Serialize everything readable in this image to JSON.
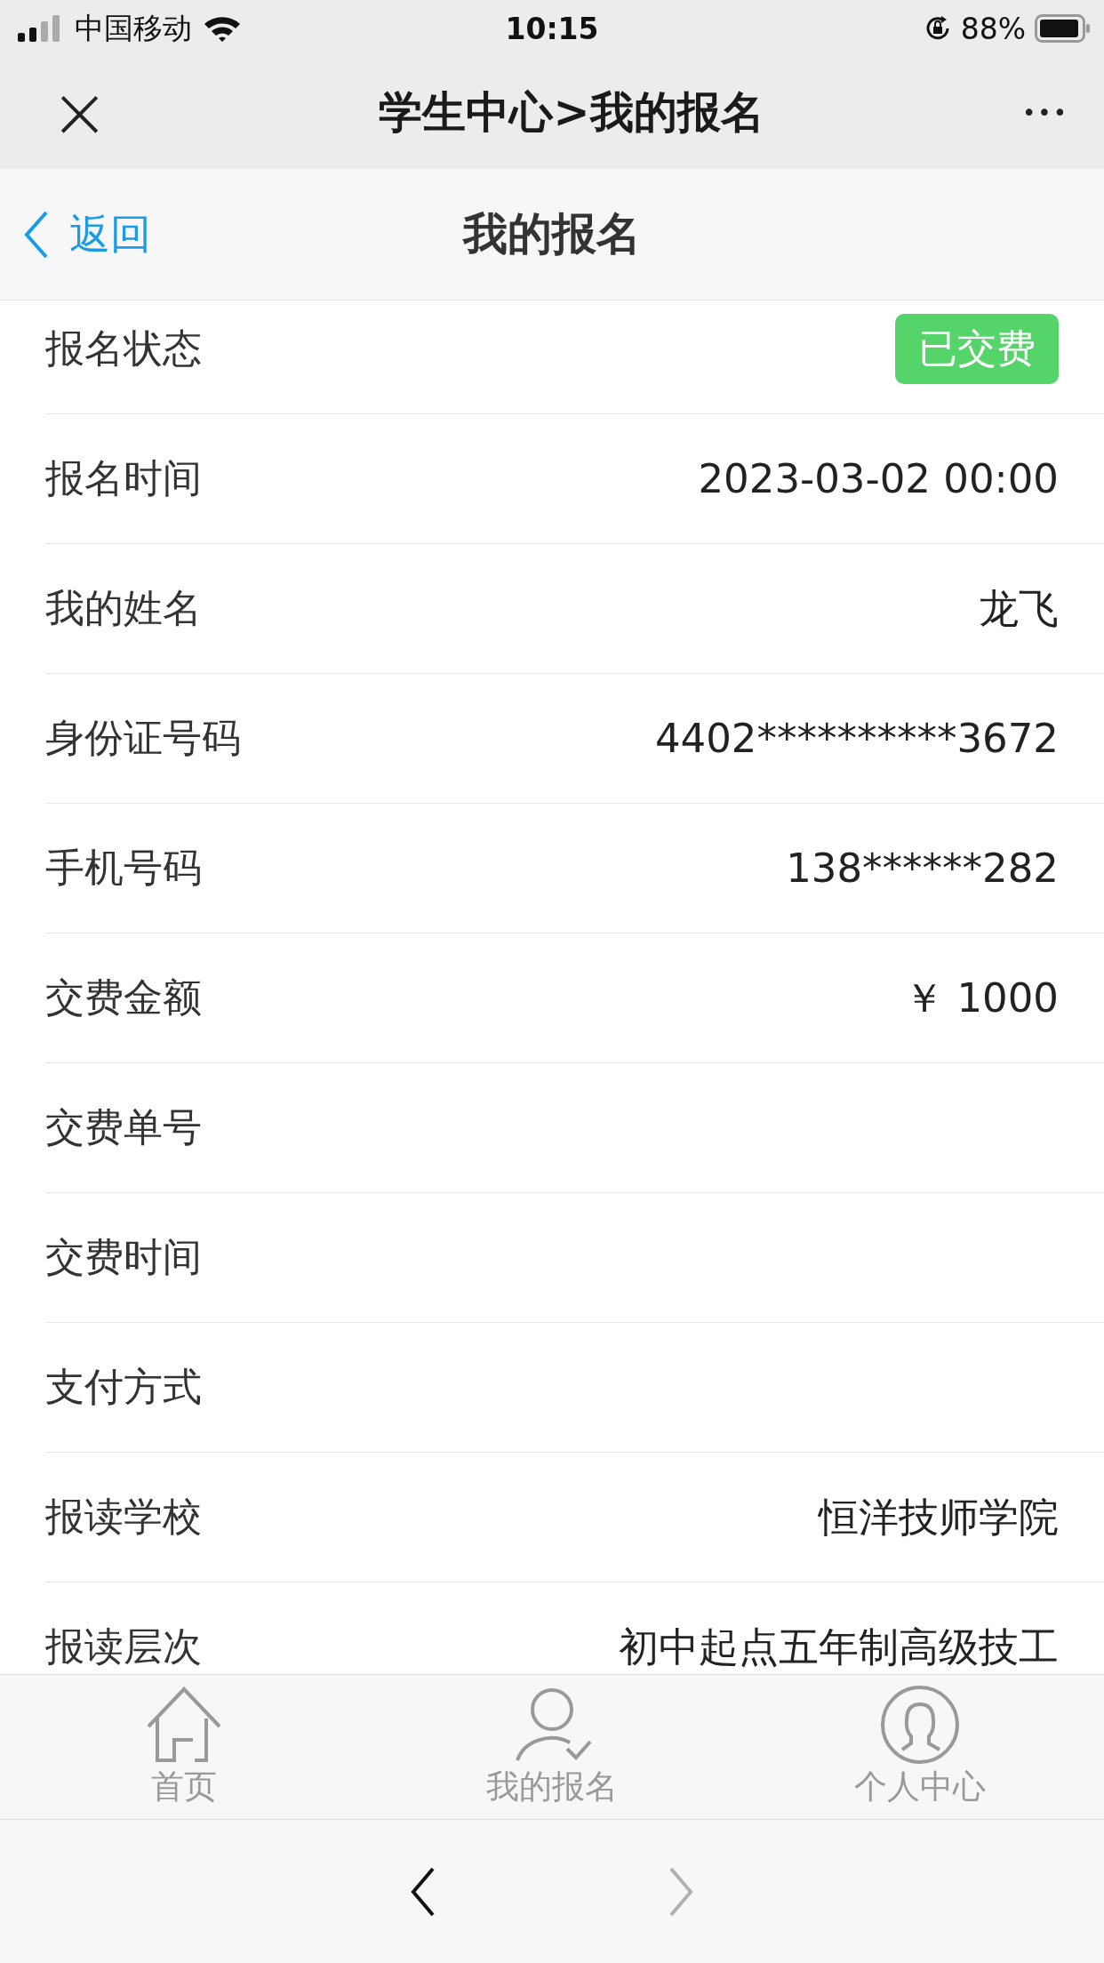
{
  "status_bar": {
    "carrier": "中国移动",
    "time": "10:15",
    "battery": "88%"
  },
  "nav_bar": {
    "close": "×",
    "title": "学生中心>我的报名",
    "more": "•••"
  },
  "page_header": {
    "back": "返回",
    "title": "我的报名"
  },
  "rows": [
    {
      "kind": "badge",
      "label": "报名状态",
      "value": "已交费",
      "color": "#55d46a"
    },
    {
      "kind": "text",
      "label": "报名时间",
      "value": "2023-03-02 00:00"
    },
    {
      "kind": "text",
      "label": "我的姓名",
      "value": "龙飞"
    },
    {
      "kind": "text",
      "label": "身份证号码",
      "value": "4402**********3672"
    },
    {
      "kind": "text",
      "label": "手机号码",
      "value": "138******282"
    },
    {
      "kind": "text",
      "label": "交费金额",
      "value": "￥ 1000"
    },
    {
      "kind": "text",
      "label": "交费单号"
    },
    {
      "kind": "text",
      "label": "交费时间"
    },
    {
      "kind": "text",
      "label": "支付方式"
    },
    {
      "kind": "text",
      "label": "报读学校",
      "value": "恒洋技师学院"
    },
    {
      "kind": "text",
      "label": "报读层次",
      "value": "初中起点五年制高级技工"
    }
  ],
  "tab_bar": [
    {
      "kind": "home",
      "label": "首页",
      "selected": false
    },
    {
      "kind": "signup",
      "label": "我的报名",
      "selected": false
    },
    {
      "kind": "profile",
      "label": "个人中心",
      "selected": false
    }
  ],
  "browser_bar": {
    "back": {
      "disabled": false
    },
    "forward": {
      "disabled": true
    }
  }
}
